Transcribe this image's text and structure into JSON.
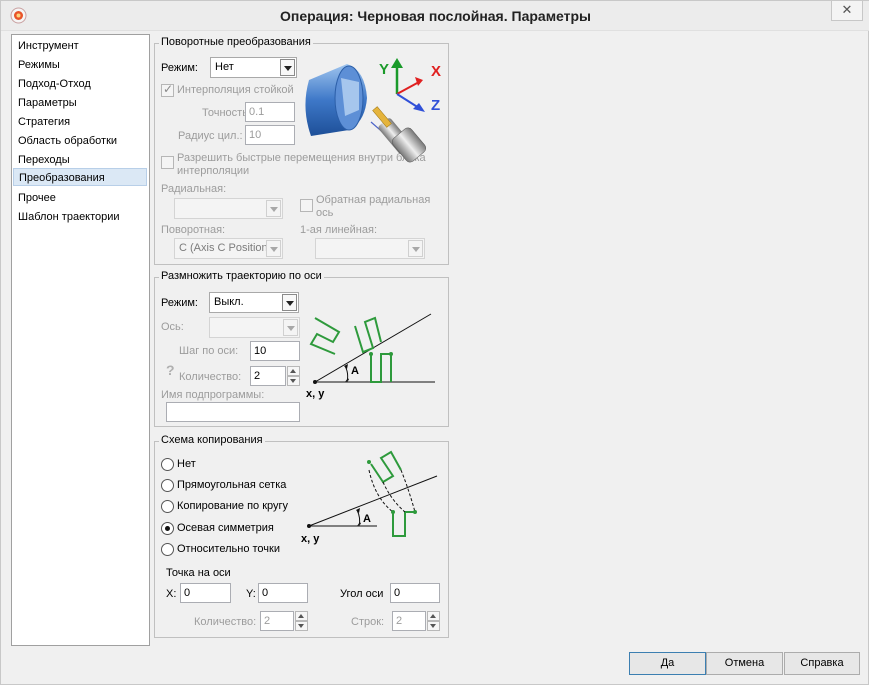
{
  "window": {
    "title": "Операция: Черновая послойная. Параметры",
    "close_glyph": "✕"
  },
  "nav": {
    "items": [
      "Инструмент",
      "Режимы",
      "Подход-Отход",
      "Параметры",
      "Стратегия",
      "Область обработки",
      "Переходы",
      "Преобразования",
      "Прочее",
      "Шаблон траектории"
    ],
    "selected": "Преобразования"
  },
  "rotary": {
    "title": "Поворотные преобразования",
    "mode_label": "Режим:",
    "mode_value": "Нет",
    "interp_label": "Интерполяция стойкой",
    "interp_checked": true,
    "precision_label": "Точность:",
    "precision_value": "0.1",
    "radius_label": "Радиус цил.:",
    "radius_value": "10",
    "fast_label_1": "Разрешить быстрые перемещения внутри блока",
    "fast_label_2": "интерполяции",
    "radial_label": "Радиальная:",
    "radial_value": "",
    "reverse_label_1": "Обратная радиальная",
    "reverse_label_2": "ось",
    "rotary_label": "Поворотная:",
    "rotary_value": "C (Axis C Position",
    "linear_label": "1-ая линейная:",
    "linear_value": "",
    "axis_labels": {
      "y": "Y",
      "x": "X",
      "z": "Z"
    },
    "colors": {
      "y": "#1a9a2a",
      "x": "#e02020",
      "z": "#3050d8"
    }
  },
  "multiply": {
    "title": "Размножить траекторию по оси",
    "mode_label": "Режим:",
    "mode_value": "Выкл.",
    "axis_label": "Ось:",
    "axis_value": "",
    "step_label": "Шаг по оси:",
    "step_value": "10",
    "count_label": "Количество:",
    "count_value": "2",
    "help_glyph": "?",
    "subprog_label": "Имя подпрограммы:",
    "subprog_value": "",
    "diagram": {
      "angle_label": "A",
      "origin_label": "x, y"
    }
  },
  "copy": {
    "title": "Схема копирования",
    "options": [
      "Нет",
      "Прямоугольная сетка",
      "Копирование по кругу",
      "Осевая симметрия",
      "Относительно точки"
    ],
    "selected": "Осевая симметрия",
    "point_label": "Точка на оси",
    "x_label": "X:",
    "x_value": "0",
    "y_label": "Y:",
    "y_value": "0",
    "angle_label": "Угол оси",
    "angle_value": "0",
    "count_label": "Количество:",
    "count_value": "2",
    "rows_label": "Строк:",
    "rows_value": "2",
    "diagram": {
      "angle_label": "A",
      "origin_label": "x, y"
    }
  },
  "buttons": {
    "ok": "Да",
    "cancel": "Отмена",
    "help": "Справка"
  }
}
